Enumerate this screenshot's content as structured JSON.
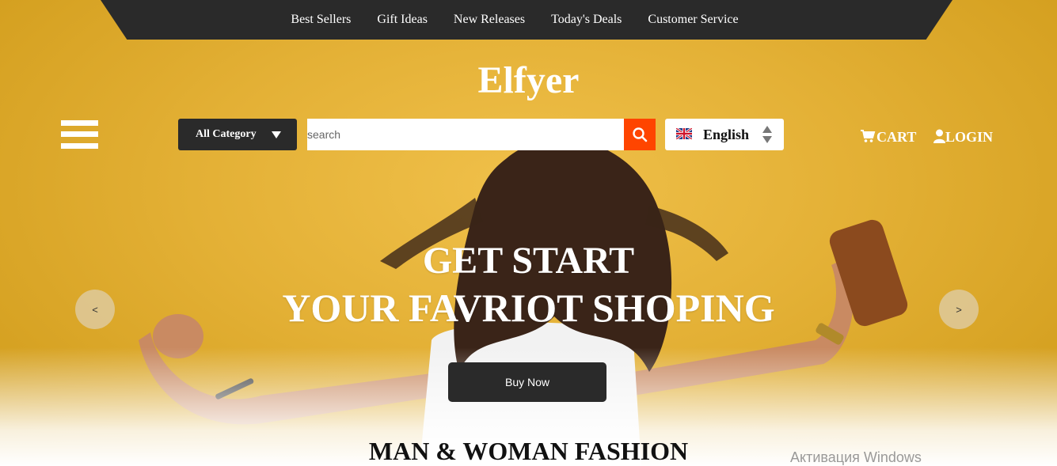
{
  "nav": {
    "links": [
      "Best Sellers",
      "Gift Ideas",
      "New Releases",
      "Today's Deals",
      "Customer Service"
    ]
  },
  "brand": {
    "name": "Elfyer"
  },
  "search": {
    "category_label": "All Category",
    "placeholder": "search"
  },
  "language": {
    "selected": "English"
  },
  "header_actions": {
    "cart_label": "CART",
    "login_label": "LOGIN"
  },
  "hero": {
    "line1": "GET START",
    "line2": "YOUR FAVRIOT SHOPING",
    "prev_label": "<",
    "next_label": ">",
    "cta_label": "Buy Now"
  },
  "section": {
    "title": "MAN & WOMAN FASHION"
  },
  "os_watermark": "Активация Windows",
  "colors": {
    "background": "#e3b035",
    "dark": "#2a2a2a",
    "accent": "#ff4500",
    "text_light": "#ffffff"
  },
  "icons": {
    "menu": "hamburger-icon",
    "category_caret": "caret-down-icon",
    "search": "search-icon",
    "flag": "uk-flag-icon",
    "language_arrows": "up-down-arrows-icon",
    "cart": "cart-icon",
    "user": "user-icon"
  }
}
